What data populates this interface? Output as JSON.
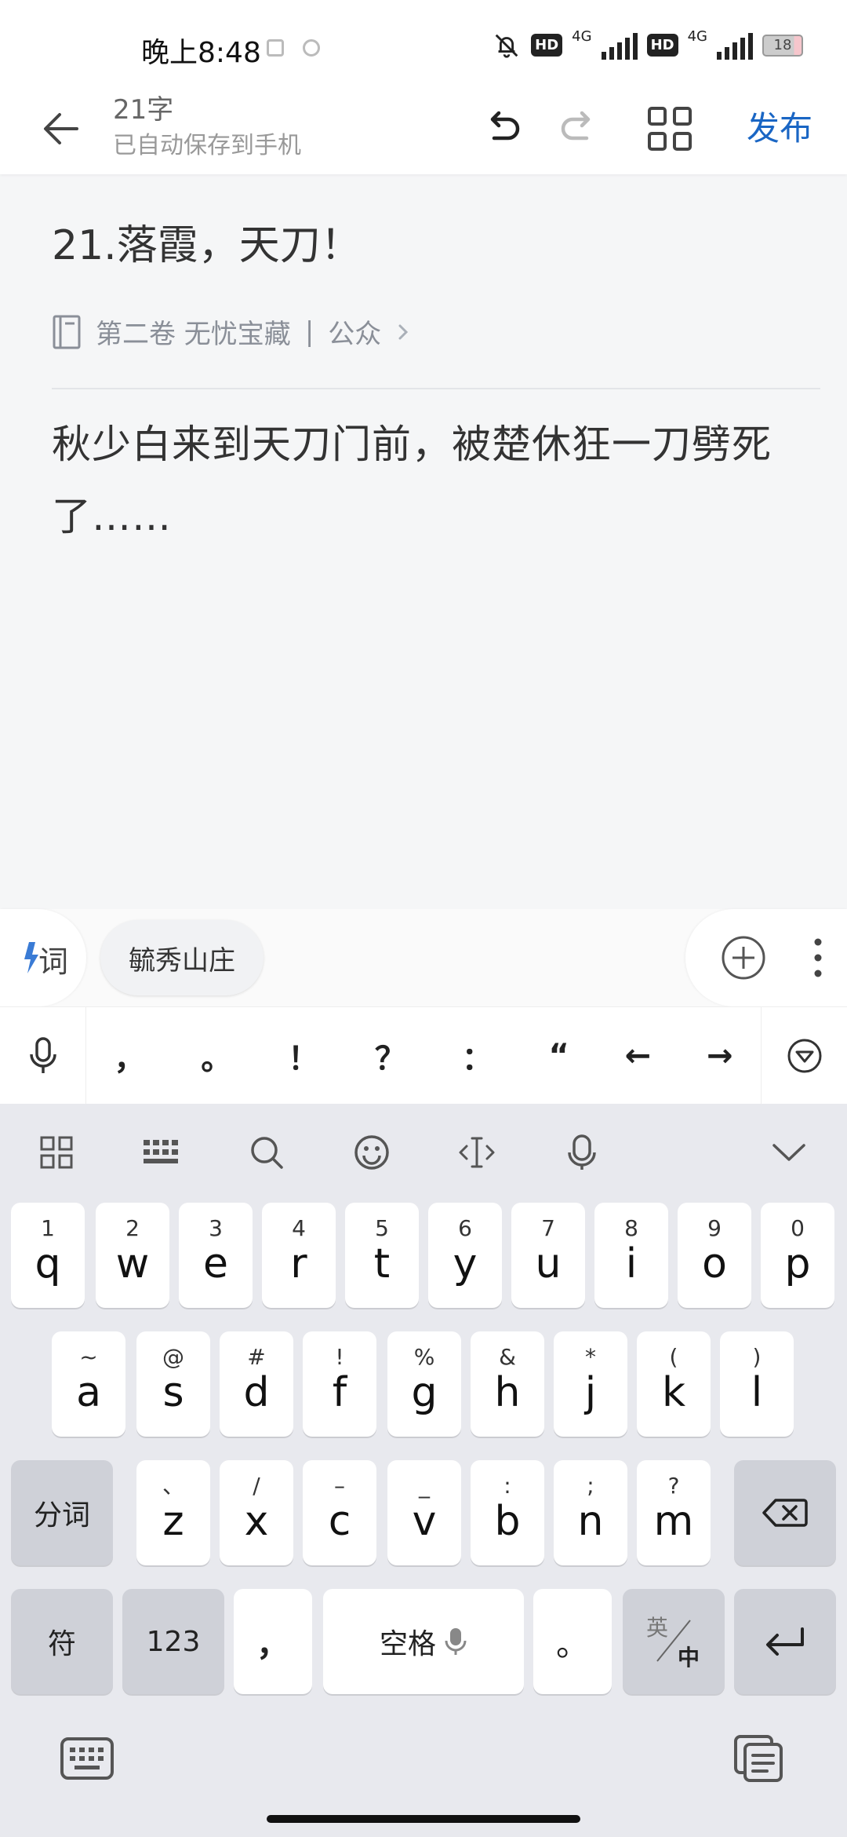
{
  "status_bar": {
    "time": "晚上8:48",
    "hd1": "HD",
    "net1": "4G",
    "hd2": "HD",
    "net2": "4G",
    "battery": "18"
  },
  "header": {
    "word_count": "21字",
    "save_status": "已自动保存到手机",
    "publish_label": "发布"
  },
  "document": {
    "title": "21.落霞，天刀！",
    "volume": "第二卷 无忧宝藏",
    "separator": "|",
    "tag": "公众",
    "body": "秋少白来到天刀门前，被楚休狂一刀劈死了……"
  },
  "suggestion": {
    "chip": "毓秀山庄"
  },
  "punctuation": [
    "，",
    "。",
    "！",
    "？",
    "：",
    "“",
    "←",
    "→"
  ],
  "keyboard": {
    "row1": [
      {
        "main": "q",
        "sub": "1"
      },
      {
        "main": "w",
        "sub": "2"
      },
      {
        "main": "e",
        "sub": "3"
      },
      {
        "main": "r",
        "sub": "4"
      },
      {
        "main": "t",
        "sub": "5"
      },
      {
        "main": "y",
        "sub": "6"
      },
      {
        "main": "u",
        "sub": "7"
      },
      {
        "main": "i",
        "sub": "8"
      },
      {
        "main": "o",
        "sub": "9"
      },
      {
        "main": "p",
        "sub": "0"
      }
    ],
    "row2": [
      {
        "main": "a",
        "sub": "~"
      },
      {
        "main": "s",
        "sub": "@"
      },
      {
        "main": "d",
        "sub": "#"
      },
      {
        "main": "f",
        "sub": "!"
      },
      {
        "main": "g",
        "sub": "%"
      },
      {
        "main": "h",
        "sub": "&"
      },
      {
        "main": "j",
        "sub": "*"
      },
      {
        "main": "k",
        "sub": "("
      },
      {
        "main": "l",
        "sub": ")"
      }
    ],
    "row3": [
      {
        "main": "z",
        "sub": "、"
      },
      {
        "main": "x",
        "sub": "/"
      },
      {
        "main": "c",
        "sub": "–"
      },
      {
        "main": "v",
        "sub": "_"
      },
      {
        "main": "b",
        "sub": ":"
      },
      {
        "main": "n",
        "sub": ";"
      },
      {
        "main": "m",
        "sub": "?"
      }
    ],
    "segment_label": "分词",
    "symbol_label": "符",
    "numbers_label": "123",
    "comma_label": "，",
    "space_label": "空格",
    "period_label": "。",
    "lang_top": "英",
    "lang_bottom": "中"
  },
  "colors": {
    "accent": "#1a66c4",
    "keyboard_bg": "#e8e9ee",
    "key_dark": "#cfd1d8"
  }
}
